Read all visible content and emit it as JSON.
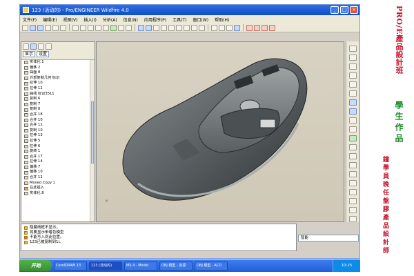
{
  "window": {
    "title": "123 (活动的) - Pro/ENGINEER Wildfire 4.0",
    "menu": [
      "文件(F)",
      "编辑(E)",
      "视图(V)",
      "插入(I)",
      "分析(A)",
      "信息(N)",
      "应用程序(P)",
      "工具(T)",
      "窗口(W)",
      "帮助(H)"
    ]
  },
  "model_tree": {
    "view_label": "显示",
    "settings_label": "设置",
    "items": [
      "实体化 1",
      "偏移 2",
      "曲面 8",
      "外部复制几何 标识",
      "拉伸 10",
      "拉伸 12",
      "曲线 标识3511",
      "复制 6",
      "复制 7",
      "复制 8",
      "合并 18",
      "合并 10",
      "合并 11",
      "复制 10",
      "拉伸 13",
      "拉伸 5",
      "拉伸 6",
      "旋转 1",
      "合并 17",
      "拉伸 14",
      "偏移 7",
      "偏移 10",
      "合并 12",
      "Moved Copy 1",
      "在此插入",
      "实体化 8"
    ]
  },
  "messages": [
    "隐藏线框不显示。",
    "将要显示带着色模型",
    "不能写入到此位置。",
    "123已被复制到1i。"
  ],
  "status": {
    "filter_value": "智能"
  },
  "taskbar": {
    "start_label": "开始",
    "tasks": [
      "CorelDRAW 13",
      "123 (活动的)",
      "MS 4 - Model",
      "OBJ 模型 - 资源",
      "OBJ 模型 - ACD"
    ],
    "clock": "10:25"
  },
  "caption": {
    "line1": "PRO/E產品設計班",
    "line2": "學生作品",
    "line3": "鐘學員晚任盤膠產品設計師"
  },
  "colors": {
    "caption_red": "#c4122a",
    "caption_green": "#1a8a2a",
    "model_gray": "#5c6265"
  }
}
